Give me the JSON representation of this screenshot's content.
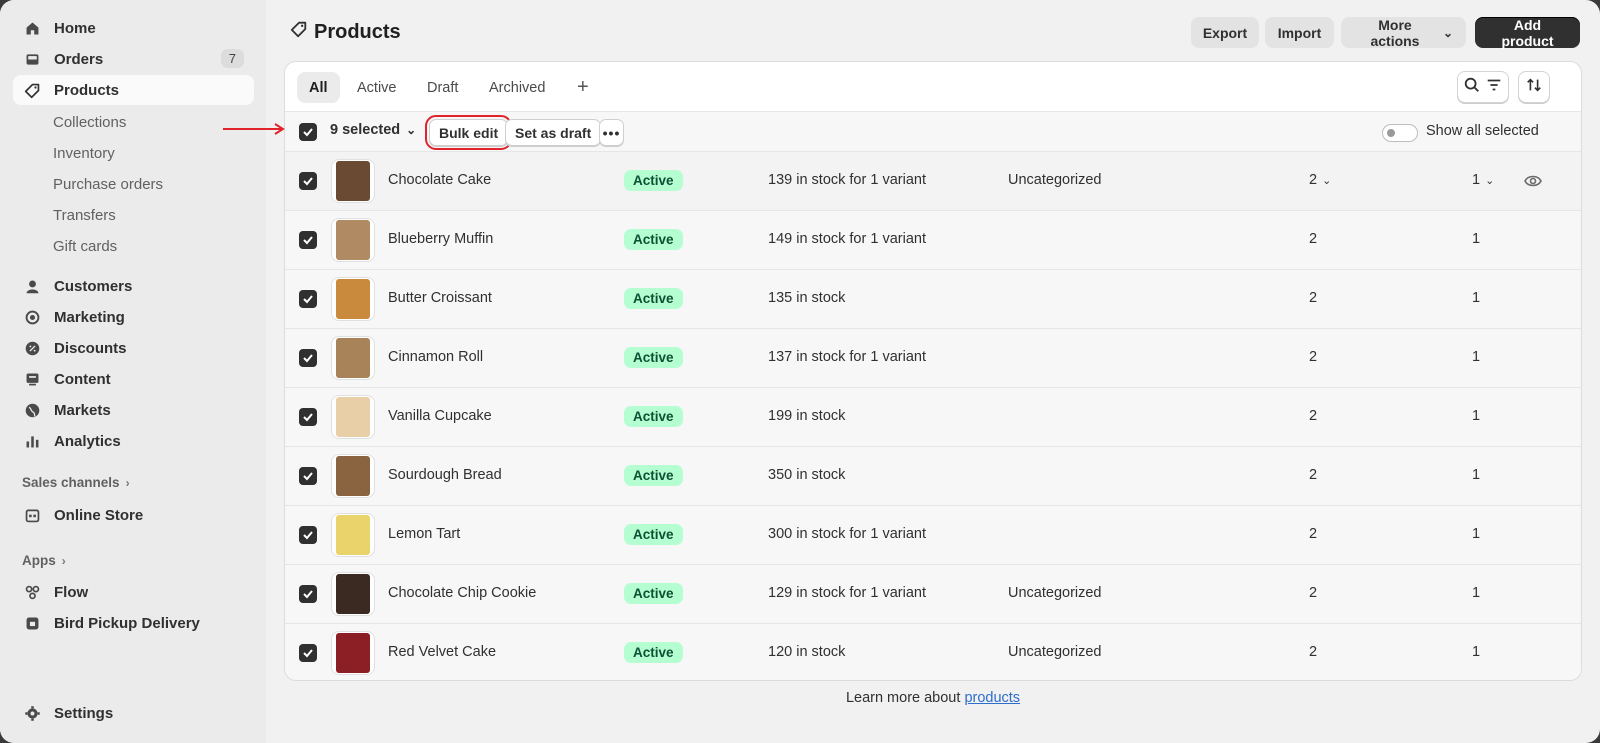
{
  "sidebar": {
    "nav": [
      {
        "label": "Home",
        "icon": "home-icon"
      },
      {
        "label": "Orders",
        "icon": "inbox-icon",
        "badge": "7"
      },
      {
        "label": "Products",
        "icon": "tag-icon",
        "active": true
      }
    ],
    "product_sub": [
      "Collections",
      "Inventory",
      "Purchase orders",
      "Transfers",
      "Gift cards"
    ],
    "nav2": [
      {
        "label": "Customers",
        "icon": "person-icon"
      },
      {
        "label": "Marketing",
        "icon": "target-icon"
      },
      {
        "label": "Discounts",
        "icon": "discount-icon"
      },
      {
        "label": "Content",
        "icon": "content-icon"
      },
      {
        "label": "Markets",
        "icon": "globe-icon"
      },
      {
        "label": "Analytics",
        "icon": "chart-icon"
      }
    ],
    "sales_channels_label": "Sales channels",
    "online_store": "Online Store",
    "apps_label": "Apps",
    "apps": [
      {
        "label": "Flow",
        "icon": "flow-icon"
      },
      {
        "label": "Bird Pickup Delivery",
        "icon": "app-icon"
      }
    ],
    "settings": "Settings"
  },
  "header": {
    "title": "Products",
    "export": "Export",
    "import": "Import",
    "more_actions": "More actions",
    "add_product": "Add product"
  },
  "tabs": [
    "All",
    "Active",
    "Draft",
    "Archived"
  ],
  "bulk": {
    "selected": "9 selected",
    "bulk_edit": "Bulk edit",
    "set_draft": "Set as draft",
    "show_all": "Show all selected"
  },
  "products": [
    {
      "name": "Chocolate Cake",
      "status": "Active",
      "inventory": "139 in stock for 1 variant",
      "category": "Uncategorized",
      "c1": "2",
      "c2": "1",
      "color": "#6b4a33"
    },
    {
      "name": "Blueberry Muffin",
      "status": "Active",
      "inventory": "149 in stock for 1 variant",
      "category": "",
      "c1": "2",
      "c2": "1",
      "color": "#b08a62"
    },
    {
      "name": "Butter Croissant",
      "status": "Active",
      "inventory": "135 in stock",
      "category": "",
      "c1": "2",
      "c2": "1",
      "color": "#c98a3e"
    },
    {
      "name": "Cinnamon Roll",
      "status": "Active",
      "inventory": "137 in stock for 1 variant",
      "category": "",
      "c1": "2",
      "c2": "1",
      "color": "#a8835a"
    },
    {
      "name": "Vanilla Cupcake",
      "status": "Active",
      "inventory": "199 in stock",
      "category": "",
      "c1": "2",
      "c2": "1",
      "color": "#e8cfa8"
    },
    {
      "name": "Sourdough Bread",
      "status": "Active",
      "inventory": "350 in stock",
      "category": "",
      "c1": "2",
      "c2": "1",
      "color": "#8a6440"
    },
    {
      "name": "Lemon Tart",
      "status": "Active",
      "inventory": "300 in stock for 1 variant",
      "category": "",
      "c1": "2",
      "c2": "1",
      "color": "#e9d36a"
    },
    {
      "name": "Chocolate Chip Cookie",
      "status": "Active",
      "inventory": "129 in stock for 1 variant",
      "category": "Uncategorized",
      "c1": "2",
      "c2": "1",
      "color": "#3a2a22"
    },
    {
      "name": "Red Velvet Cake",
      "status": "Active",
      "inventory": "120 in stock",
      "category": "Uncategorized",
      "c1": "2",
      "c2": "1",
      "color": "#8c1f25"
    }
  ],
  "footer": {
    "text": "Learn more about ",
    "link": "products"
  }
}
